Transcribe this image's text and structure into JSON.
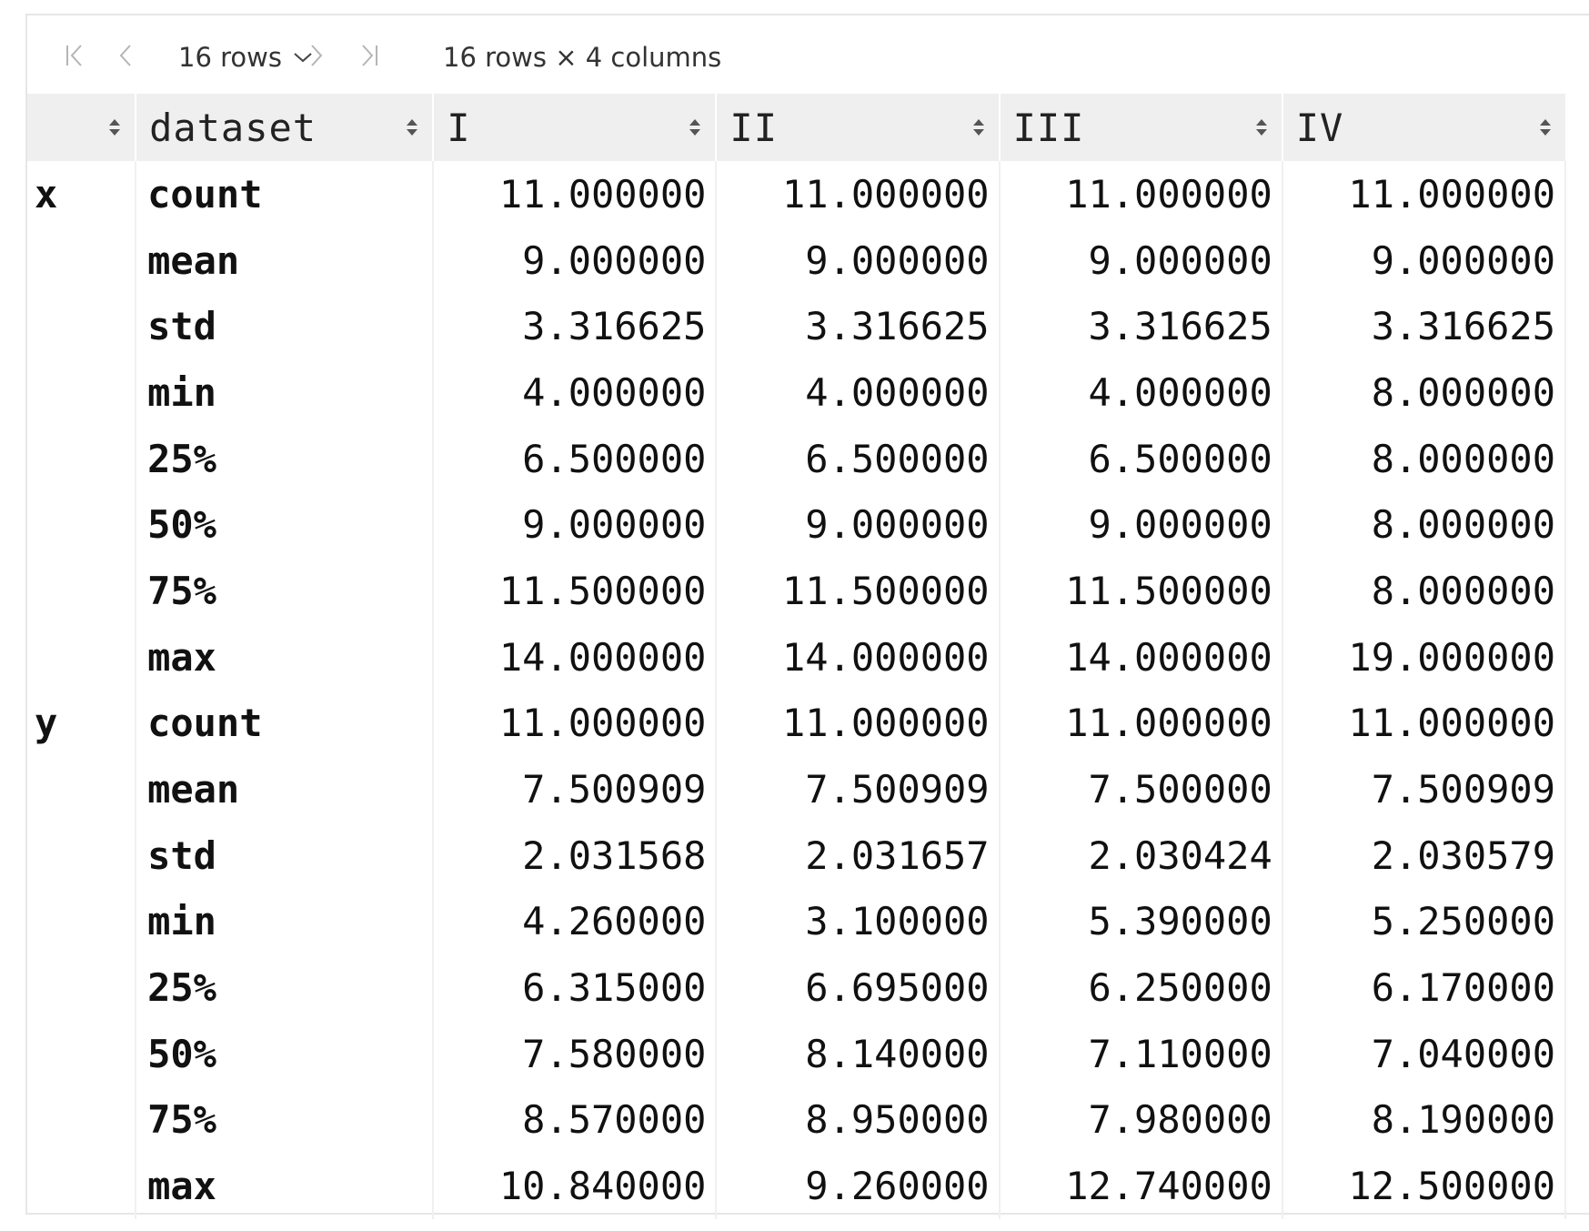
{
  "toolbar": {
    "rows_label": "16 rows",
    "summary": "16 rows × 4 columns"
  },
  "table": {
    "headers": [
      "",
      "dataset",
      "I",
      "II",
      "III",
      "IV"
    ],
    "rows": [
      {
        "index": "x",
        "stat": "count",
        "values": [
          "11.000000",
          "11.000000",
          "11.000000",
          "11.000000"
        ]
      },
      {
        "index": "",
        "stat": "mean",
        "values": [
          "9.000000",
          "9.000000",
          "9.000000",
          "9.000000"
        ]
      },
      {
        "index": "",
        "stat": "std",
        "values": [
          "3.316625",
          "3.316625",
          "3.316625",
          "3.316625"
        ]
      },
      {
        "index": "",
        "stat": "min",
        "values": [
          "4.000000",
          "4.000000",
          "4.000000",
          "8.000000"
        ]
      },
      {
        "index": "",
        "stat": "25%",
        "values": [
          "6.500000",
          "6.500000",
          "6.500000",
          "8.000000"
        ]
      },
      {
        "index": "",
        "stat": "50%",
        "values": [
          "9.000000",
          "9.000000",
          "9.000000",
          "8.000000"
        ]
      },
      {
        "index": "",
        "stat": "75%",
        "values": [
          "11.500000",
          "11.500000",
          "11.500000",
          "8.000000"
        ]
      },
      {
        "index": "",
        "stat": "max",
        "values": [
          "14.000000",
          "14.000000",
          "14.000000",
          "19.000000"
        ]
      },
      {
        "index": "y",
        "stat": "count",
        "values": [
          "11.000000",
          "11.000000",
          "11.000000",
          "11.000000"
        ]
      },
      {
        "index": "",
        "stat": "mean",
        "values": [
          "7.500909",
          "7.500909",
          "7.500000",
          "7.500909"
        ]
      },
      {
        "index": "",
        "stat": "std",
        "values": [
          "2.031568",
          "2.031657",
          "2.030424",
          "2.030579"
        ]
      },
      {
        "index": "",
        "stat": "min",
        "values": [
          "4.260000",
          "3.100000",
          "5.390000",
          "5.250000"
        ]
      },
      {
        "index": "",
        "stat": "25%",
        "values": [
          "6.315000",
          "6.695000",
          "6.250000",
          "6.170000"
        ]
      },
      {
        "index": "",
        "stat": "50%",
        "values": [
          "7.580000",
          "8.140000",
          "7.110000",
          "7.040000"
        ]
      },
      {
        "index": "",
        "stat": "75%",
        "values": [
          "8.570000",
          "8.950000",
          "7.980000",
          "8.190000"
        ]
      },
      {
        "index": "",
        "stat": "max",
        "values": [
          "10.840000",
          "9.260000",
          "12.740000",
          "12.500000"
        ]
      }
    ]
  }
}
